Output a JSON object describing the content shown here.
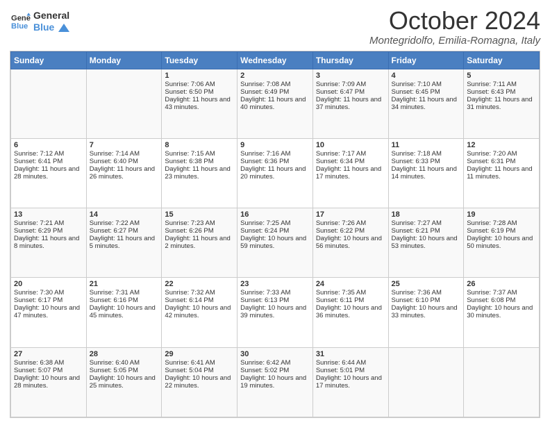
{
  "header": {
    "logo_line1": "General",
    "logo_line2": "Blue",
    "title": "October 2024",
    "subtitle": "Montegridolfo, Emilia-Romagna, Italy"
  },
  "days_of_week": [
    "Sunday",
    "Monday",
    "Tuesday",
    "Wednesday",
    "Thursday",
    "Friday",
    "Saturday"
  ],
  "weeks": [
    [
      {
        "day": "",
        "sunrise": "",
        "sunset": "",
        "daylight": ""
      },
      {
        "day": "",
        "sunrise": "",
        "sunset": "",
        "daylight": ""
      },
      {
        "day": "1",
        "sunrise": "Sunrise: 7:06 AM",
        "sunset": "Sunset: 6:50 PM",
        "daylight": "Daylight: 11 hours and 43 minutes."
      },
      {
        "day": "2",
        "sunrise": "Sunrise: 7:08 AM",
        "sunset": "Sunset: 6:49 PM",
        "daylight": "Daylight: 11 hours and 40 minutes."
      },
      {
        "day": "3",
        "sunrise": "Sunrise: 7:09 AM",
        "sunset": "Sunset: 6:47 PM",
        "daylight": "Daylight: 11 hours and 37 minutes."
      },
      {
        "day": "4",
        "sunrise": "Sunrise: 7:10 AM",
        "sunset": "Sunset: 6:45 PM",
        "daylight": "Daylight: 11 hours and 34 minutes."
      },
      {
        "day": "5",
        "sunrise": "Sunrise: 7:11 AM",
        "sunset": "Sunset: 6:43 PM",
        "daylight": "Daylight: 11 hours and 31 minutes."
      }
    ],
    [
      {
        "day": "6",
        "sunrise": "Sunrise: 7:12 AM",
        "sunset": "Sunset: 6:41 PM",
        "daylight": "Daylight: 11 hours and 28 minutes."
      },
      {
        "day": "7",
        "sunrise": "Sunrise: 7:14 AM",
        "sunset": "Sunset: 6:40 PM",
        "daylight": "Daylight: 11 hours and 26 minutes."
      },
      {
        "day": "8",
        "sunrise": "Sunrise: 7:15 AM",
        "sunset": "Sunset: 6:38 PM",
        "daylight": "Daylight: 11 hours and 23 minutes."
      },
      {
        "day": "9",
        "sunrise": "Sunrise: 7:16 AM",
        "sunset": "Sunset: 6:36 PM",
        "daylight": "Daylight: 11 hours and 20 minutes."
      },
      {
        "day": "10",
        "sunrise": "Sunrise: 7:17 AM",
        "sunset": "Sunset: 6:34 PM",
        "daylight": "Daylight: 11 hours and 17 minutes."
      },
      {
        "day": "11",
        "sunrise": "Sunrise: 7:18 AM",
        "sunset": "Sunset: 6:33 PM",
        "daylight": "Daylight: 11 hours and 14 minutes."
      },
      {
        "day": "12",
        "sunrise": "Sunrise: 7:20 AM",
        "sunset": "Sunset: 6:31 PM",
        "daylight": "Daylight: 11 hours and 11 minutes."
      }
    ],
    [
      {
        "day": "13",
        "sunrise": "Sunrise: 7:21 AM",
        "sunset": "Sunset: 6:29 PM",
        "daylight": "Daylight: 11 hours and 8 minutes."
      },
      {
        "day": "14",
        "sunrise": "Sunrise: 7:22 AM",
        "sunset": "Sunset: 6:27 PM",
        "daylight": "Daylight: 11 hours and 5 minutes."
      },
      {
        "day": "15",
        "sunrise": "Sunrise: 7:23 AM",
        "sunset": "Sunset: 6:26 PM",
        "daylight": "Daylight: 11 hours and 2 minutes."
      },
      {
        "day": "16",
        "sunrise": "Sunrise: 7:25 AM",
        "sunset": "Sunset: 6:24 PM",
        "daylight": "Daylight: 10 hours and 59 minutes."
      },
      {
        "day": "17",
        "sunrise": "Sunrise: 7:26 AM",
        "sunset": "Sunset: 6:22 PM",
        "daylight": "Daylight: 10 hours and 56 minutes."
      },
      {
        "day": "18",
        "sunrise": "Sunrise: 7:27 AM",
        "sunset": "Sunset: 6:21 PM",
        "daylight": "Daylight: 10 hours and 53 minutes."
      },
      {
        "day": "19",
        "sunrise": "Sunrise: 7:28 AM",
        "sunset": "Sunset: 6:19 PM",
        "daylight": "Daylight: 10 hours and 50 minutes."
      }
    ],
    [
      {
        "day": "20",
        "sunrise": "Sunrise: 7:30 AM",
        "sunset": "Sunset: 6:17 PM",
        "daylight": "Daylight: 10 hours and 47 minutes."
      },
      {
        "day": "21",
        "sunrise": "Sunrise: 7:31 AM",
        "sunset": "Sunset: 6:16 PM",
        "daylight": "Daylight: 10 hours and 45 minutes."
      },
      {
        "day": "22",
        "sunrise": "Sunrise: 7:32 AM",
        "sunset": "Sunset: 6:14 PM",
        "daylight": "Daylight: 10 hours and 42 minutes."
      },
      {
        "day": "23",
        "sunrise": "Sunrise: 7:33 AM",
        "sunset": "Sunset: 6:13 PM",
        "daylight": "Daylight: 10 hours and 39 minutes."
      },
      {
        "day": "24",
        "sunrise": "Sunrise: 7:35 AM",
        "sunset": "Sunset: 6:11 PM",
        "daylight": "Daylight: 10 hours and 36 minutes."
      },
      {
        "day": "25",
        "sunrise": "Sunrise: 7:36 AM",
        "sunset": "Sunset: 6:10 PM",
        "daylight": "Daylight: 10 hours and 33 minutes."
      },
      {
        "day": "26",
        "sunrise": "Sunrise: 7:37 AM",
        "sunset": "Sunset: 6:08 PM",
        "daylight": "Daylight: 10 hours and 30 minutes."
      }
    ],
    [
      {
        "day": "27",
        "sunrise": "Sunrise: 6:38 AM",
        "sunset": "Sunset: 5:07 PM",
        "daylight": "Daylight: 10 hours and 28 minutes."
      },
      {
        "day": "28",
        "sunrise": "Sunrise: 6:40 AM",
        "sunset": "Sunset: 5:05 PM",
        "daylight": "Daylight: 10 hours and 25 minutes."
      },
      {
        "day": "29",
        "sunrise": "Sunrise: 6:41 AM",
        "sunset": "Sunset: 5:04 PM",
        "daylight": "Daylight: 10 hours and 22 minutes."
      },
      {
        "day": "30",
        "sunrise": "Sunrise: 6:42 AM",
        "sunset": "Sunset: 5:02 PM",
        "daylight": "Daylight: 10 hours and 19 minutes."
      },
      {
        "day": "31",
        "sunrise": "Sunrise: 6:44 AM",
        "sunset": "Sunset: 5:01 PM",
        "daylight": "Daylight: 10 hours and 17 minutes."
      },
      {
        "day": "",
        "sunrise": "",
        "sunset": "",
        "daylight": ""
      },
      {
        "day": "",
        "sunrise": "",
        "sunset": "",
        "daylight": ""
      }
    ]
  ]
}
